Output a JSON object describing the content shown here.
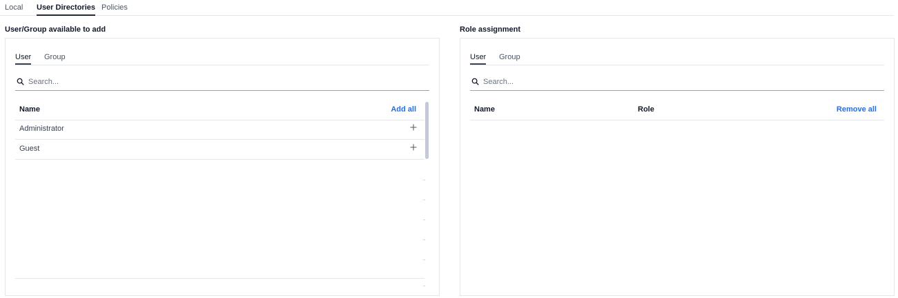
{
  "top_tabs": [
    {
      "label": "Local"
    },
    {
      "label": "User Directories"
    },
    {
      "label": "Policies"
    }
  ],
  "available": {
    "title": "User/Group available to add",
    "tabs": [
      {
        "label": "User"
      },
      {
        "label": "Group"
      }
    ],
    "search": {
      "placeholder": "Search..."
    },
    "columns": {
      "name": "Name"
    },
    "add_all_label": "Add all",
    "rows": [
      {
        "name": "Administrator",
        "action_icon": "plus-icon"
      },
      {
        "name": "Guest",
        "action_icon": "plus-icon"
      }
    ]
  },
  "assignment": {
    "title": "Role assignment",
    "tabs": [
      {
        "label": "User"
      },
      {
        "label": "Group"
      }
    ],
    "search": {
      "placeholder": "Search..."
    },
    "columns": {
      "name": "Name",
      "role": "Role"
    },
    "remove_all_label": "Remove all"
  },
  "colors": {
    "accent": "#1f6feb",
    "text": "#111827",
    "border": "#e5e7eb"
  }
}
